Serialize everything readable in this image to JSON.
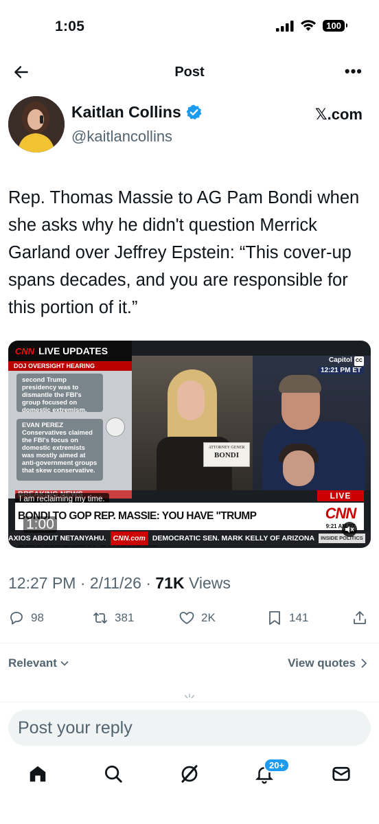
{
  "status_bar": {
    "time": "1:05",
    "battery": "100"
  },
  "header": {
    "title": "Post",
    "more": "•••"
  },
  "author": {
    "name": "Kaitlan Collins",
    "handle": "@kaitlancollins",
    "source": "𝕏.com"
  },
  "post": {
    "text": "Rep. Thomas Massie to AG Pam Bondi when she asks why he didn't question Merrick Garland over Jeffrey Epstein: “This cover-up spans decades, and you are responsible for this portion of it.”"
  },
  "media": {
    "cnn_header": "LIVE UPDATES",
    "cnn_logo": "CNN",
    "cnn_subhead": "DOJ OVERSIGHT HEARING",
    "card1": "second Trump presidency was to dismantle the FBI's group focused on domestic extremism.",
    "reporter": "EVAN PEREZ",
    "card2": "Conservatives claimed the FBI's focus on domestic extremists was mostly aimed at anti-government groups that skew conservative.",
    "nameplate_small": "ATTORNEY GENER",
    "nameplate_big": "BONDI",
    "location": "Capitol",
    "cc": "CC",
    "clock": "12:21 PM ET",
    "breaking": "BREAKING NEWS",
    "caption": "I am reclaiming my time.",
    "live": "LIVE",
    "chyron": "BONDI TO GOP REP. MASSIE: YOU HAVE \"TRUMP DERANGEMENT SYNDROME\"",
    "chyron_logo": "CNN",
    "chyron_clock": "9:21 AM PT",
    "ticker_left": "AXIOS ABOUT NETANYAHU.",
    "ticker_cnn": "CNN.com",
    "ticker_right": "DEMOCRATIC SEN. MARK KELLY OF ARIZONA",
    "ticker_tag": "INSIDE POLITICS",
    "duration": "1:00"
  },
  "meta": {
    "time": "12:27 PM",
    "date": "2/11/26",
    "views_count": "71K",
    "views_label": "Views",
    "sep": "·"
  },
  "actions": {
    "replies": "98",
    "reposts": "381",
    "likes": "2K",
    "bookmarks": "141"
  },
  "replies_section": {
    "sort_label": "Relevant",
    "view_quotes": "View quotes"
  },
  "reply_placeholder": "Post your reply",
  "tabbar": {
    "notifications_badge": "20+"
  },
  "colors": {
    "accent": "#1d9bf0",
    "secondary_text": "#536471",
    "cnn_red": "#cc0000"
  }
}
